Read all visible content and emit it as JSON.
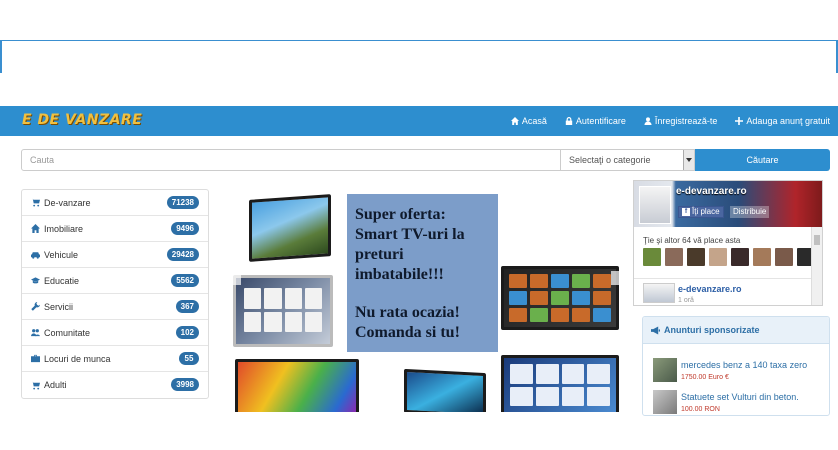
{
  "header": {
    "logo": "E DE VANZARE",
    "nav": [
      {
        "label": "Acasă",
        "icon": "home-icon"
      },
      {
        "label": "Autentificare",
        "icon": "lock-icon"
      },
      {
        "label": "Înregistrează-te",
        "icon": "user-icon"
      },
      {
        "label": "Adauga anunţ gratuit",
        "icon": "plus-icon"
      }
    ]
  },
  "search": {
    "placeholder": "Cauta",
    "category_select": "Selectaţi o categorie",
    "button": "Căutare"
  },
  "categories": [
    {
      "label": "De-vanzare",
      "count": "71238",
      "icon": "cart-icon"
    },
    {
      "label": "Imobiliare",
      "count": "9496",
      "icon": "home-icon"
    },
    {
      "label": "Vehicule",
      "count": "29428",
      "icon": "car-icon"
    },
    {
      "label": "Educatie",
      "count": "5562",
      "icon": "graduation-cap-icon"
    },
    {
      "label": "Servicii",
      "count": "367",
      "icon": "wrench-icon"
    },
    {
      "label": "Comunitate",
      "count": "102",
      "icon": "users-icon"
    },
    {
      "label": "Locuri de munca",
      "count": "55",
      "icon": "briefcase-icon"
    },
    {
      "label": "Adulti",
      "count": "3998",
      "icon": "cart-icon"
    }
  ],
  "banner": {
    "headline": "Super oferta: Smart TV-uri la preturi imbatabile!!!",
    "tagline": "Nu rata ocazia! Comanda si tu!"
  },
  "facebook": {
    "cover_title": "e-devanzare.ro",
    "like_button": "Îţi place",
    "share_button": "Distribuie",
    "likes_text": "Ţie şi altor 64 vă place asta",
    "page_title": "e-devanzare.ro",
    "page_sub": "1 oră"
  },
  "sponsored": {
    "title": "Anunturi sponsorizate",
    "ads": [
      {
        "title": "mercedes benz a 140 taxa zero",
        "price": "1750.00 Euro €"
      },
      {
        "title": "Statuete set Vulturi din beton.",
        "price": "100.00 RON"
      }
    ]
  }
}
